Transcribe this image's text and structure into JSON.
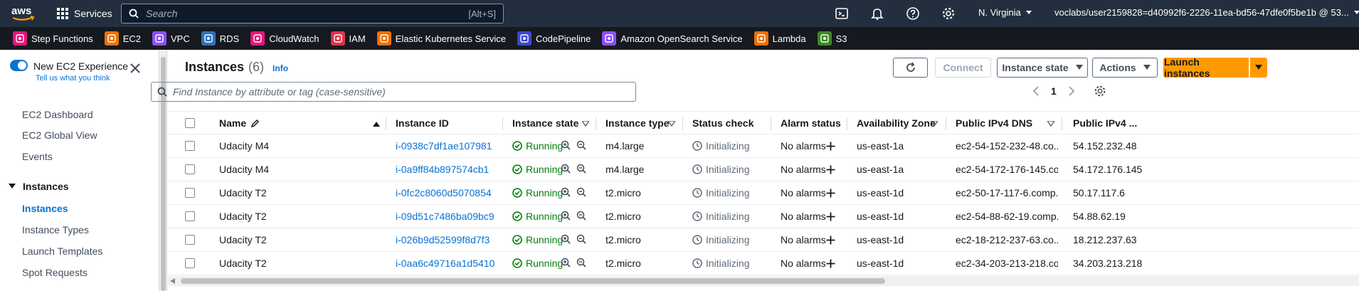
{
  "topnav": {
    "services_label": "Services",
    "search_placeholder": "Search",
    "search_shortcut": "[Alt+S]",
    "region": "N. Virginia",
    "account": "voclabs/user2159828=d40992f6-2226-11ea-bd56-47dfe0f5be1b @ 53..."
  },
  "favorites": [
    {
      "label": "Step Functions",
      "icon": "step-functions-icon",
      "color": "#e7157b"
    },
    {
      "label": "EC2",
      "icon": "ec2-icon",
      "color": "#ed7100"
    },
    {
      "label": "VPC",
      "icon": "vpc-icon",
      "color": "#8c4fff"
    },
    {
      "label": "RDS",
      "icon": "rds-icon",
      "color": "#2e73b8"
    },
    {
      "label": "CloudWatch",
      "icon": "cloudwatch-icon",
      "color": "#e7157b"
    },
    {
      "label": "IAM",
      "icon": "iam-icon",
      "color": "#dd344c"
    },
    {
      "label": "Elastic Kubernetes Service",
      "icon": "eks-icon",
      "color": "#ed7100"
    },
    {
      "label": "CodePipeline",
      "icon": "codepipeline-icon",
      "color": "#3f48cc"
    },
    {
      "label": "Amazon OpenSearch Service",
      "icon": "opensearch-icon",
      "color": "#8c4fff"
    },
    {
      "label": "Lambda",
      "icon": "lambda-icon",
      "color": "#ed7100"
    },
    {
      "label": "S3",
      "icon": "s3-icon",
      "color": "#3f8624"
    }
  ],
  "sidebar": {
    "new_experience": "New EC2 Experience",
    "tell_us": "Tell us what you think",
    "dashboard": "EC2 Dashboard",
    "global_view": "EC2 Global View",
    "events": "Events",
    "section_instances": "Instances",
    "instances": "Instances",
    "instance_types": "Instance Types",
    "launch_templates": "Launch Templates",
    "spot_requests": "Spot Requests"
  },
  "main": {
    "title": "Instances",
    "count": "(6)",
    "info": "Info",
    "connect": "Connect",
    "instance_state": "Instance state",
    "actions": "Actions",
    "launch": "Launch instances",
    "filter_placeholder": "Find Instance by attribute or tag (case-sensitive)",
    "page": "1"
  },
  "columns": {
    "name": "Name",
    "id": "Instance ID",
    "state": "Instance state",
    "type": "Instance type",
    "status": "Status check",
    "alarm": "Alarm status",
    "az": "Availability Zone",
    "dns": "Public IPv4 DNS",
    "ip": "Public IPv4 ..."
  },
  "rows": [
    {
      "name": "Udacity M4",
      "id": "i-0938c7df1ae107981",
      "state": "Running",
      "type": "m4.large",
      "status": "Initializing",
      "alarm": "No alarms",
      "az": "us-east-1a",
      "dns": "ec2-54-152-232-48.co...",
      "ip": "54.152.232.48"
    },
    {
      "name": "Udacity M4",
      "id": "i-0a9ff84b897574cb1",
      "state": "Running",
      "type": "m4.large",
      "status": "Initializing",
      "alarm": "No alarms",
      "az": "us-east-1a",
      "dns": "ec2-54-172-176-145.co...",
      "ip": "54.172.176.145"
    },
    {
      "name": "Udacity T2",
      "id": "i-0fc2c8060d5070854",
      "state": "Running",
      "type": "t2.micro",
      "status": "Initializing",
      "alarm": "No alarms",
      "az": "us-east-1d",
      "dns": "ec2-50-17-117-6.comp...",
      "ip": "50.17.117.6"
    },
    {
      "name": "Udacity T2",
      "id": "i-09d51c7486ba09bc9",
      "state": "Running",
      "type": "t2.micro",
      "status": "Initializing",
      "alarm": "No alarms",
      "az": "us-east-1d",
      "dns": "ec2-54-88-62-19.comp...",
      "ip": "54.88.62.19"
    },
    {
      "name": "Udacity T2",
      "id": "i-026b9d52599f8d7f3",
      "state": "Running",
      "type": "t2.micro",
      "status": "Initializing",
      "alarm": "No alarms",
      "az": "us-east-1d",
      "dns": "ec2-18-212-237-63.co...",
      "ip": "18.212.237.63"
    },
    {
      "name": "Udacity T2",
      "id": "i-0aa6c49716a1d5410",
      "state": "Running",
      "type": "t2.micro",
      "status": "Initializing",
      "alarm": "No alarms",
      "az": "us-east-1d",
      "dns": "ec2-34-203-213-218.co...",
      "ip": "34.203.213.218"
    }
  ]
}
